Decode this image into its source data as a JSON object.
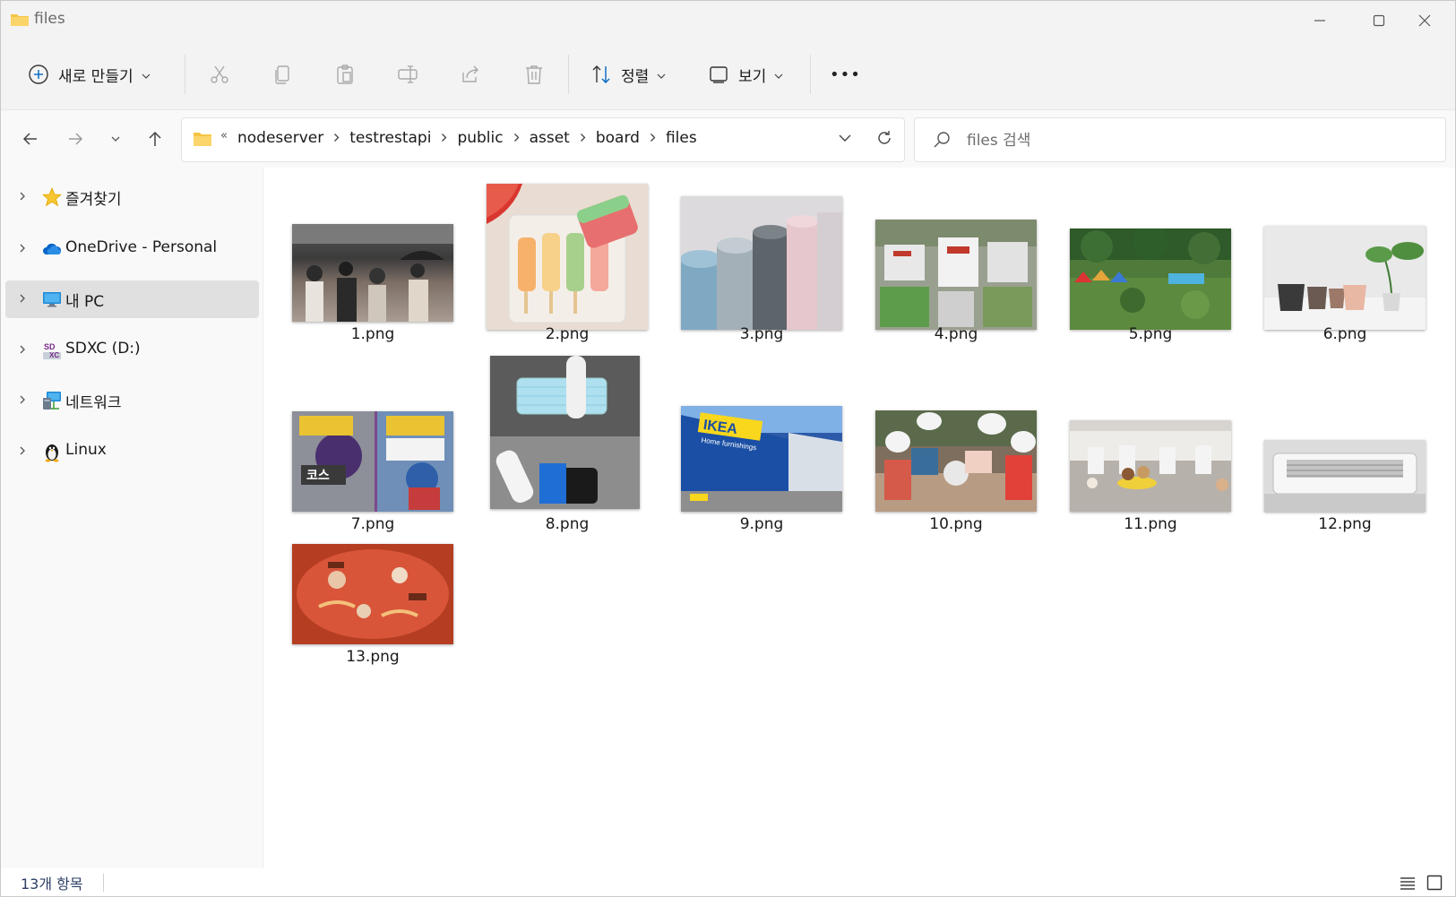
{
  "window": {
    "title": "files"
  },
  "toolbar": {
    "new_label": "새로 만들기",
    "sort_label": "정렬",
    "view_label": "보기",
    "more_label": "•••"
  },
  "address": {
    "overflow": "«",
    "crumbs": [
      "nodeserver",
      "testrestapi",
      "public",
      "asset",
      "board",
      "files"
    ]
  },
  "search": {
    "placeholder": "files 검색"
  },
  "sidebar": {
    "items": [
      {
        "label": "즐겨찾기",
        "icon": "star-icon"
      },
      {
        "label": "OneDrive - Personal",
        "icon": "cloud-icon"
      },
      {
        "label": "내 PC",
        "icon": "monitor-icon",
        "selected": true
      },
      {
        "label": "SDXC (D:)",
        "icon": "sd-card-icon"
      },
      {
        "label": "네트워크",
        "icon": "network-icon"
      },
      {
        "label": "Linux",
        "icon": "penguin-icon"
      }
    ]
  },
  "files": [
    {
      "name": "1.png"
    },
    {
      "name": "2.png"
    },
    {
      "name": "3.png"
    },
    {
      "name": "4.png"
    },
    {
      "name": "5.png"
    },
    {
      "name": "6.png"
    },
    {
      "name": "7.png"
    },
    {
      "name": "8.png"
    },
    {
      "name": "9.png"
    },
    {
      "name": "10.png"
    },
    {
      "name": "11.png"
    },
    {
      "name": "12.png"
    },
    {
      "name": "13.png"
    }
  ],
  "status": {
    "count": "13개 항목"
  },
  "colors": {
    "accent": "#0067c0",
    "folder": "#f5c542",
    "selected_bg": "#e0e0e0"
  }
}
